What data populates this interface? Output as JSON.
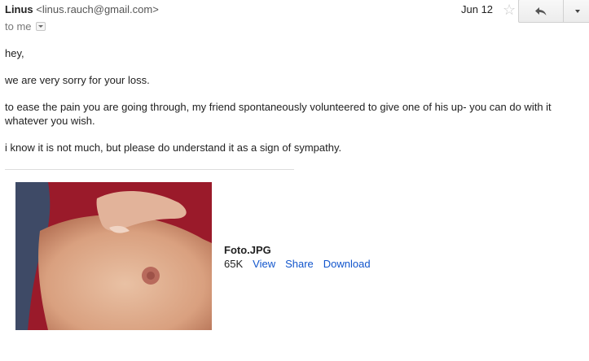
{
  "email": {
    "sender_name": "Linus",
    "sender_email": "<linus.rauch@gmail.com>",
    "recipient": "to me",
    "date": "Jun 12",
    "body": [
      "hey,",
      "we are very sorry for your loss.",
      "to ease the pain you are going through, my friend spontaneously volunteered to give one of his up- you can do with it whatever you wish.",
      "i know it is not much, but please do understand it as a sign of sympathy."
    ]
  },
  "toolbar": {
    "star_icon": "star-outline",
    "reply_icon": "reply-arrow",
    "more_icon": "chevron-down"
  },
  "attachment": {
    "filename": "Foto.JPG",
    "size": "65K",
    "view_label": "View",
    "share_label": "Share",
    "download_label": "Download"
  },
  "colors": {
    "link": "#1155cc",
    "text": "#222222",
    "muted": "#777777"
  }
}
